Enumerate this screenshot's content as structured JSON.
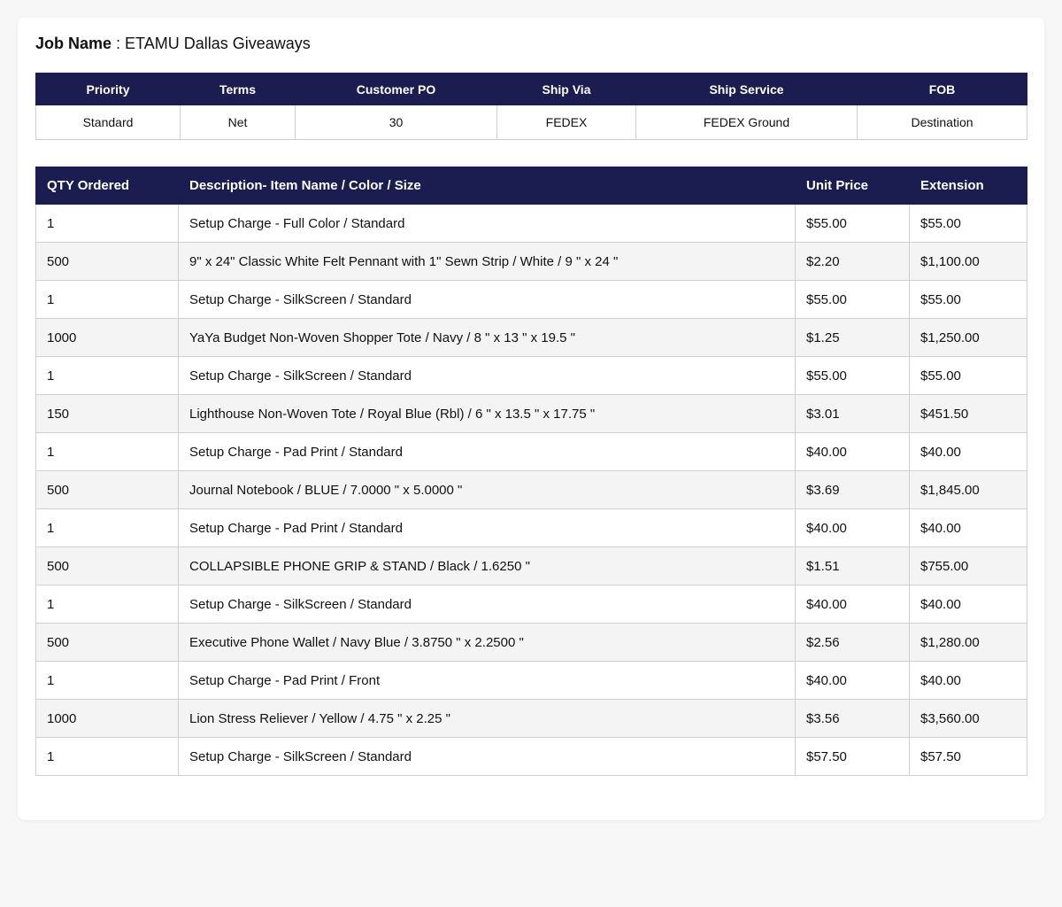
{
  "job": {
    "label": "Job Name",
    "separator": " : ",
    "value": "ETAMU Dallas Giveaways"
  },
  "info": {
    "headers": [
      "Priority",
      "Terms",
      "Customer PO",
      "Ship Via",
      "Ship Service",
      "FOB"
    ],
    "values": [
      "Standard",
      "Net",
      "30",
      "FEDEX",
      "FEDEX Ground",
      "Destination"
    ]
  },
  "items": {
    "headers": [
      "QTY Ordered",
      "Description- Item Name / Color / Size",
      "Unit Price",
      "Extension"
    ],
    "rows": [
      [
        "1",
        "Setup Charge - Full Color / Standard",
        "$55.00",
        "$55.00"
      ],
      [
        "500",
        "9\" x 24\" Classic White Felt Pennant with 1\" Sewn Strip / White / 9 \" x 24 \"",
        "$2.20",
        "$1,100.00"
      ],
      [
        "1",
        "Setup Charge - SilkScreen / Standard",
        "$55.00",
        "$55.00"
      ],
      [
        "1000",
        "YaYa Budget Non-Woven Shopper Tote / Navy / 8 \" x 13 \" x 19.5 \"",
        "$1.25",
        "$1,250.00"
      ],
      [
        "1",
        "Setup Charge - SilkScreen / Standard",
        "$55.00",
        "$55.00"
      ],
      [
        "150",
        "Lighthouse Non-Woven Tote / Royal Blue (Rbl) / 6 \" x 13.5 \" x 17.75 \"",
        "$3.01",
        "$451.50"
      ],
      [
        "1",
        "Setup Charge - Pad Print / Standard",
        "$40.00",
        "$40.00"
      ],
      [
        "500",
        "Journal Notebook / BLUE / 7.0000 \" x 5.0000 \"",
        "$3.69",
        "$1,845.00"
      ],
      [
        "1",
        "Setup Charge - Pad Print / Standard",
        "$40.00",
        "$40.00"
      ],
      [
        "500",
        "COLLAPSIBLE PHONE GRIP & STAND / Black / 1.6250 \"",
        "$1.51",
        "$755.00"
      ],
      [
        "1",
        "Setup Charge - SilkScreen / Standard",
        "$40.00",
        "$40.00"
      ],
      [
        "500",
        "Executive Phone Wallet / Navy Blue / 3.8750 \" x 2.2500 \"",
        "$2.56",
        "$1,280.00"
      ],
      [
        "1",
        "Setup Charge - Pad Print / Front",
        "$40.00",
        "$40.00"
      ],
      [
        "1000",
        "Lion Stress Reliever / Yellow / 4.75 \" x 2.25 \"",
        "$3.56",
        "$3,560.00"
      ],
      [
        "1",
        "Setup Charge - SilkScreen / Standard",
        "$57.50",
        "$57.50"
      ]
    ]
  }
}
